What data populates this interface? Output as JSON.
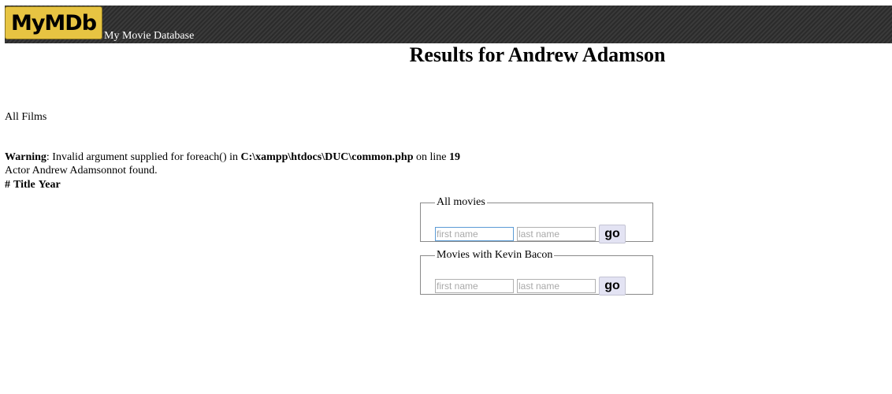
{
  "banner": {
    "logo_text": "MyMDb",
    "site_title": "My Movie Database"
  },
  "page_title": "Results for Andrew Adamson",
  "all_films_label": "All Films",
  "warning": {
    "label": "Warning",
    "text_before_path": ": Invalid argument supplied for foreach() in ",
    "path": "C:\\xampp\\htdocs\\DUC\\common.php",
    "text_before_line": " on line ",
    "line": "19"
  },
  "not_found_message": "Actor Andrew Adamsonnot found.",
  "table_headers": [
    "#",
    "Title",
    "Year"
  ],
  "forms": {
    "all_movies": {
      "legend": "All movies",
      "first_name_placeholder": "first name",
      "last_name_placeholder": "last name",
      "go_label": "go"
    },
    "kevin_bacon": {
      "legend": "Movies with Kevin Bacon",
      "first_name_placeholder": "first name",
      "last_name_placeholder": "last name",
      "go_label": "go"
    }
  },
  "colors": {
    "logo_background": "#e7c442",
    "banner_background": "#333333",
    "go_button_background": "#e3e3f3"
  }
}
